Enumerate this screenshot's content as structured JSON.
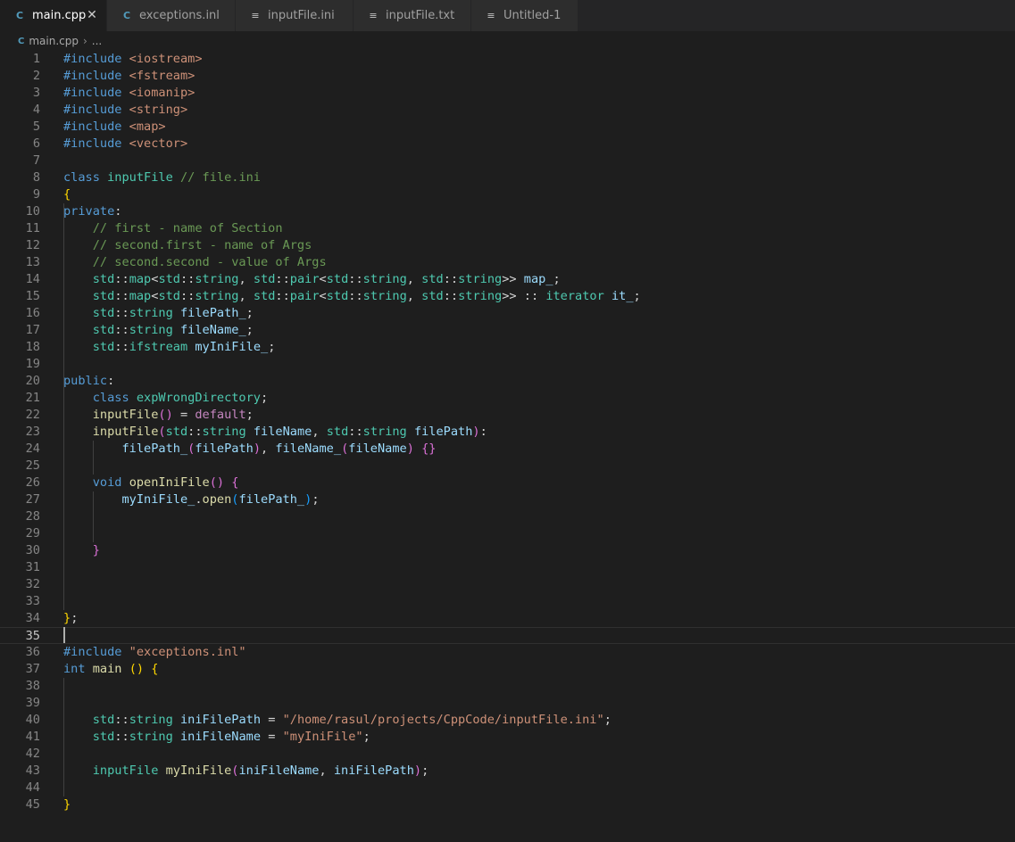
{
  "tabs": [
    {
      "label": "main.cpp",
      "icon": "cpp-file-icon",
      "active": true
    },
    {
      "label": "exceptions.inl",
      "icon": "cpp-file-icon",
      "active": false
    },
    {
      "label": "inputFile.ini",
      "icon": "text-file-icon",
      "active": false
    },
    {
      "label": "inputFile.txt",
      "icon": "text-file-icon",
      "active": false
    },
    {
      "label": "Untitled-1",
      "icon": "text-file-icon",
      "active": false
    }
  ],
  "breadcrumb": {
    "file": "main.cpp",
    "more": "..."
  },
  "editor": {
    "current_line": 35,
    "lines": [
      [
        [
          "pp",
          "#include"
        ],
        [
          "",
          "",
          " "
        ],
        [
          "inc",
          "<iostream>"
        ]
      ],
      [
        [
          "pp",
          "#include"
        ],
        [
          "",
          "",
          " "
        ],
        [
          "inc",
          "<fstream>"
        ]
      ],
      [
        [
          "pp",
          "#include"
        ],
        [
          "",
          "",
          " "
        ],
        [
          "inc",
          "<iomanip>"
        ]
      ],
      [
        [
          "pp",
          "#include"
        ],
        [
          "",
          "",
          " "
        ],
        [
          "inc",
          "<string>"
        ]
      ],
      [
        [
          "pp",
          "#include"
        ],
        [
          "",
          "",
          " "
        ],
        [
          "inc",
          "<map>"
        ]
      ],
      [
        [
          "pp",
          "#include"
        ],
        [
          "",
          "",
          " "
        ],
        [
          "inc",
          "<vector>"
        ]
      ],
      [],
      [
        [
          "kw",
          "class"
        ],
        [
          "",
          "",
          " "
        ],
        [
          "ty",
          "inputFile"
        ],
        [
          "",
          "",
          " "
        ],
        [
          "cm",
          "// file.ini"
        ]
      ],
      [
        [
          "b1",
          "{"
        ]
      ],
      [
        [
          "kw",
          "private"
        ],
        [
          "",
          "",
          ":"
        ]
      ],
      [
        [
          "",
          "",
          "    "
        ],
        [
          "cm",
          "// first - name of Section"
        ]
      ],
      [
        [
          "",
          "",
          "    "
        ],
        [
          "cm",
          "// second.first - name of Args"
        ]
      ],
      [
        [
          "",
          "",
          "    "
        ],
        [
          "cm",
          "// second.second - value of Args"
        ]
      ],
      [
        [
          "",
          "",
          "    "
        ],
        [
          "ty",
          "std"
        ],
        [
          "",
          "",
          "::"
        ],
        [
          "ty",
          "map"
        ],
        [
          "",
          "",
          "<"
        ],
        [
          "ty",
          "std"
        ],
        [
          "",
          "",
          "::"
        ],
        [
          "ty",
          "string"
        ],
        [
          "",
          "",
          ", "
        ],
        [
          "ty",
          "std"
        ],
        [
          "",
          "",
          "::"
        ],
        [
          "ty",
          "pair"
        ],
        [
          "",
          "",
          "<"
        ],
        [
          "ty",
          "std"
        ],
        [
          "",
          "",
          "::"
        ],
        [
          "ty",
          "string"
        ],
        [
          "",
          "",
          ", "
        ],
        [
          "ty",
          "std"
        ],
        [
          "",
          "",
          "::"
        ],
        [
          "ty",
          "string"
        ],
        [
          "",
          "",
          ">> "
        ],
        [
          "var",
          "map_"
        ],
        [
          "",
          "",
          ";"
        ]
      ],
      [
        [
          "",
          "",
          "    "
        ],
        [
          "ty",
          "std"
        ],
        [
          "",
          "",
          "::"
        ],
        [
          "ty",
          "map"
        ],
        [
          "",
          "",
          "<"
        ],
        [
          "ty",
          "std"
        ],
        [
          "",
          "",
          "::"
        ],
        [
          "ty",
          "string"
        ],
        [
          "",
          "",
          ", "
        ],
        [
          "ty",
          "std"
        ],
        [
          "",
          "",
          "::"
        ],
        [
          "ty",
          "pair"
        ],
        [
          "",
          "",
          "<"
        ],
        [
          "ty",
          "std"
        ],
        [
          "",
          "",
          "::"
        ],
        [
          "ty",
          "string"
        ],
        [
          "",
          "",
          ", "
        ],
        [
          "ty",
          "std"
        ],
        [
          "",
          "",
          "::"
        ],
        [
          "ty",
          "string"
        ],
        [
          "",
          "",
          ">> :: "
        ],
        [
          "ty",
          "iterator"
        ],
        [
          "",
          "",
          " "
        ],
        [
          "var",
          "it_"
        ],
        [
          "",
          "",
          ";"
        ]
      ],
      [
        [
          "",
          "",
          "    "
        ],
        [
          "ty",
          "std"
        ],
        [
          "",
          "",
          "::"
        ],
        [
          "ty",
          "string"
        ],
        [
          "",
          "",
          " "
        ],
        [
          "var",
          "filePath_"
        ],
        [
          "",
          "",
          ";"
        ]
      ],
      [
        [
          "",
          "",
          "    "
        ],
        [
          "ty",
          "std"
        ],
        [
          "",
          "",
          "::"
        ],
        [
          "ty",
          "string"
        ],
        [
          "",
          "",
          " "
        ],
        [
          "var",
          "fileName_"
        ],
        [
          "",
          "",
          ";"
        ]
      ],
      [
        [
          "",
          "",
          "    "
        ],
        [
          "ty",
          "std"
        ],
        [
          "",
          "",
          "::"
        ],
        [
          "ty",
          "ifstream"
        ],
        [
          "",
          "",
          " "
        ],
        [
          "var",
          "myIniFile_"
        ],
        [
          "",
          "",
          ";"
        ]
      ],
      [],
      [
        [
          "kw",
          "public"
        ],
        [
          "",
          "",
          ":"
        ]
      ],
      [
        [
          "",
          "",
          "    "
        ],
        [
          "kw",
          "class"
        ],
        [
          "",
          "",
          " "
        ],
        [
          "ty",
          "expWrongDirectory"
        ],
        [
          "",
          "",
          ";"
        ]
      ],
      [
        [
          "",
          "",
          "    "
        ],
        [
          "fn",
          "inputFile"
        ],
        [
          "b2",
          "()"
        ],
        [
          "",
          "",
          " = "
        ],
        [
          "ctl",
          "default"
        ],
        [
          "",
          "",
          ";"
        ]
      ],
      [
        [
          "",
          "",
          "    "
        ],
        [
          "fn",
          "inputFile"
        ],
        [
          "b2",
          "("
        ],
        [
          "ty",
          "std"
        ],
        [
          "",
          "",
          "::"
        ],
        [
          "ty",
          "string"
        ],
        [
          "",
          "",
          " "
        ],
        [
          "var",
          "fileName"
        ],
        [
          "",
          "",
          ", "
        ],
        [
          "ty",
          "std"
        ],
        [
          "",
          "",
          "::"
        ],
        [
          "ty",
          "string"
        ],
        [
          "",
          "",
          " "
        ],
        [
          "var",
          "filePath"
        ],
        [
          "b2",
          ")"
        ],
        [
          "",
          "",
          ":"
        ]
      ],
      [
        [
          "",
          "",
          "        "
        ],
        [
          "var",
          "filePath_"
        ],
        [
          "b2",
          "("
        ],
        [
          "var",
          "filePath"
        ],
        [
          "b2",
          ")"
        ],
        [
          "",
          "",
          ", "
        ],
        [
          "var",
          "fileName_"
        ],
        [
          "b2",
          "("
        ],
        [
          "var",
          "fileName"
        ],
        [
          "b2",
          ")"
        ],
        [
          "",
          "",
          " "
        ],
        [
          "b2",
          "{}"
        ]
      ],
      [],
      [
        [
          "",
          "",
          "    "
        ],
        [
          "kw",
          "void"
        ],
        [
          "",
          "",
          " "
        ],
        [
          "fn",
          "openIniFile"
        ],
        [
          "b2",
          "()"
        ],
        [
          "",
          "",
          " "
        ],
        [
          "b2",
          "{"
        ]
      ],
      [
        [
          "",
          "",
          "        "
        ],
        [
          "var",
          "myIniFile_"
        ],
        [
          "",
          "",
          "."
        ],
        [
          "fn",
          "open"
        ],
        [
          "b3",
          "("
        ],
        [
          "var",
          "filePath_"
        ],
        [
          "b3",
          ")"
        ],
        [
          "",
          "",
          ";"
        ]
      ],
      [],
      [],
      [
        [
          "",
          "",
          "    "
        ],
        [
          "b2",
          "}"
        ]
      ],
      [],
      [],
      [],
      [
        [
          "b1",
          "}"
        ],
        [
          "",
          "",
          ";"
        ]
      ],
      [],
      [
        [
          "pp",
          "#include"
        ],
        [
          "",
          "",
          " "
        ],
        [
          "str",
          "\"exceptions.inl\""
        ]
      ],
      [
        [
          "kw",
          "int"
        ],
        [
          "",
          "",
          " "
        ],
        [
          "fn",
          "main"
        ],
        [
          "",
          "",
          " "
        ],
        [
          "b1",
          "()"
        ],
        [
          "",
          "",
          " "
        ],
        [
          "b1",
          "{"
        ]
      ],
      [],
      [],
      [
        [
          "",
          "",
          "    "
        ],
        [
          "ty",
          "std"
        ],
        [
          "",
          "",
          "::"
        ],
        [
          "ty",
          "string"
        ],
        [
          "",
          "",
          " "
        ],
        [
          "var",
          "iniFilePath"
        ],
        [
          "",
          "",
          " = "
        ],
        [
          "str",
          "\"/home/rasul/projects/CppCode/inputFile.ini\""
        ],
        [
          "",
          "",
          ";"
        ]
      ],
      [
        [
          "",
          "",
          "    "
        ],
        [
          "ty",
          "std"
        ],
        [
          "",
          "",
          "::"
        ],
        [
          "ty",
          "string"
        ],
        [
          "",
          "",
          " "
        ],
        [
          "var",
          "iniFileName"
        ],
        [
          "",
          "",
          " = "
        ],
        [
          "str",
          "\"myIniFile\""
        ],
        [
          "",
          "",
          ";"
        ]
      ],
      [],
      [
        [
          "",
          "",
          "    "
        ],
        [
          "ty",
          "inputFile"
        ],
        [
          "",
          "",
          " "
        ],
        [
          "fn",
          "myIniFile"
        ],
        [
          "b2",
          "("
        ],
        [
          "var",
          "iniFileName"
        ],
        [
          "",
          "",
          ", "
        ],
        [
          "var",
          "iniFilePath"
        ],
        [
          "b2",
          ")"
        ],
        [
          "",
          "",
          ";"
        ]
      ],
      [],
      [
        [
          "b1",
          "}"
        ]
      ]
    ]
  }
}
